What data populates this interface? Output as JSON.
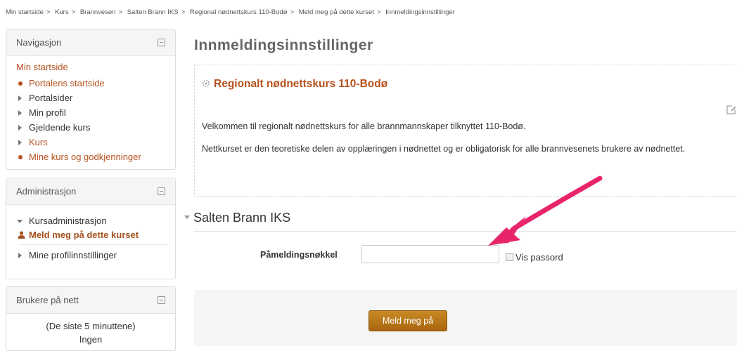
{
  "breadcrumb": [
    "Min startside",
    "Kurs",
    "Brannvesen",
    "Salten Brann IKS",
    "Regional nødnettskurs 110-Bodø",
    "Meld meg på dette kurset",
    "Innmeldingsinnstillinger"
  ],
  "breadcrumb_separator": ">",
  "navigation": {
    "title": "Navigasjon",
    "root": "Min startside",
    "items": [
      {
        "label": "Portalens startside",
        "icon": "bullet",
        "link": true
      },
      {
        "label": "Portalsider",
        "icon": "triangle",
        "link": false
      },
      {
        "label": "Min profil",
        "icon": "triangle",
        "link": false
      },
      {
        "label": "Gjeldende kurs",
        "icon": "triangle",
        "link": false
      },
      {
        "label": "Kurs",
        "icon": "triangle",
        "link": true
      },
      {
        "label": "Mine kurs og godkjenninger",
        "icon": "bullet",
        "link": true
      }
    ]
  },
  "administration": {
    "title": "Administrasjon",
    "course_admin": "Kursadministrasjon",
    "enrol_self": "Meld meg på dette kurset",
    "profile_settings": "Mine profilinnstillinger"
  },
  "online_users": {
    "title": "Brukere på nett",
    "period": "(De siste 5 minuttene)",
    "none": "Ingen"
  },
  "page": {
    "title": "Innmeldingsinnstillinger",
    "course_name": "Regionalt nødnettskurs 110-Bodø",
    "description_1": "Velkommen til regionalt nødnettskurs for alle brannmannskaper tilknyttet 110-Bodø.",
    "description_2": "Nettkurset er den teoretiske delen av opplæringen i nødnettet og er obligatorisk for alle brannvesenets brukere av nødnettet."
  },
  "enrol_form": {
    "section": "Salten Brann IKS",
    "key_label": "Påmeldingsnøkkel",
    "key_value": "",
    "show_password": "Vis passord",
    "submit": "Meld meg på"
  },
  "colors": {
    "accent": "#b5511e",
    "button": "#b8761a",
    "arrow": "#e8256a"
  }
}
